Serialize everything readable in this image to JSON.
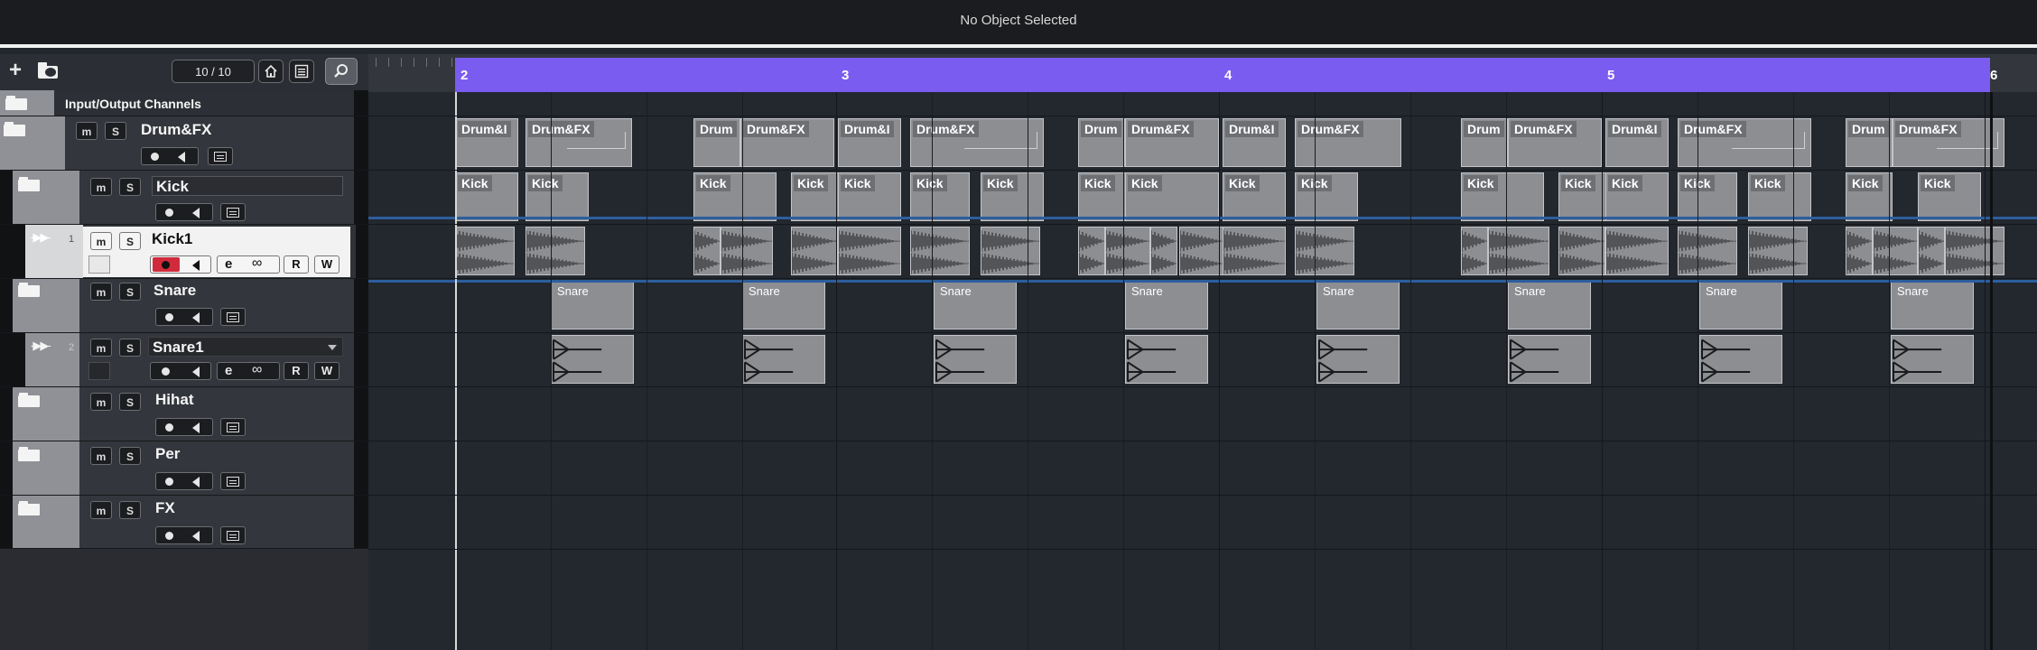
{
  "info_line": {
    "text": "No Object Selected"
  },
  "toolbar": {
    "add_label": "+",
    "count_label": "10 / 10"
  },
  "tracks": {
    "io": {
      "name": "Input/Output Channels"
    },
    "drum": {
      "name": "Drum&FX",
      "m": "m",
      "s": "S"
    },
    "kick": {
      "name": "Kick",
      "m": "m",
      "s": "S"
    },
    "kick1": {
      "name": "Kick1",
      "num": "1",
      "m": "m",
      "s": "S",
      "r": "R",
      "w": "W"
    },
    "snare": {
      "name": "Snare",
      "m": "m",
      "s": "S"
    },
    "snare1": {
      "name": "Snare1",
      "num": "2",
      "m": "m",
      "s": "S",
      "r": "R",
      "w": "W"
    },
    "hihat": {
      "name": "Hihat",
      "m": "m",
      "s": "S"
    },
    "per": {
      "name": "Per",
      "m": "m",
      "s": "S"
    },
    "fx": {
      "name": "FX",
      "m": "m",
      "s": "S"
    }
  },
  "ruler": {
    "bars": [
      "2",
      "3",
      "4",
      "5",
      "6"
    ]
  },
  "events": {
    "drum_label": "Drum&FX",
    "drum_short": "Drum&I",
    "drum_short2": "Drum",
    "kick_label": "Kick",
    "snare_label": "Snare"
  },
  "colors": {
    "cycle": "#7b5cf0",
    "selection": "#2c5e9e",
    "record": "#d12b3b"
  }
}
